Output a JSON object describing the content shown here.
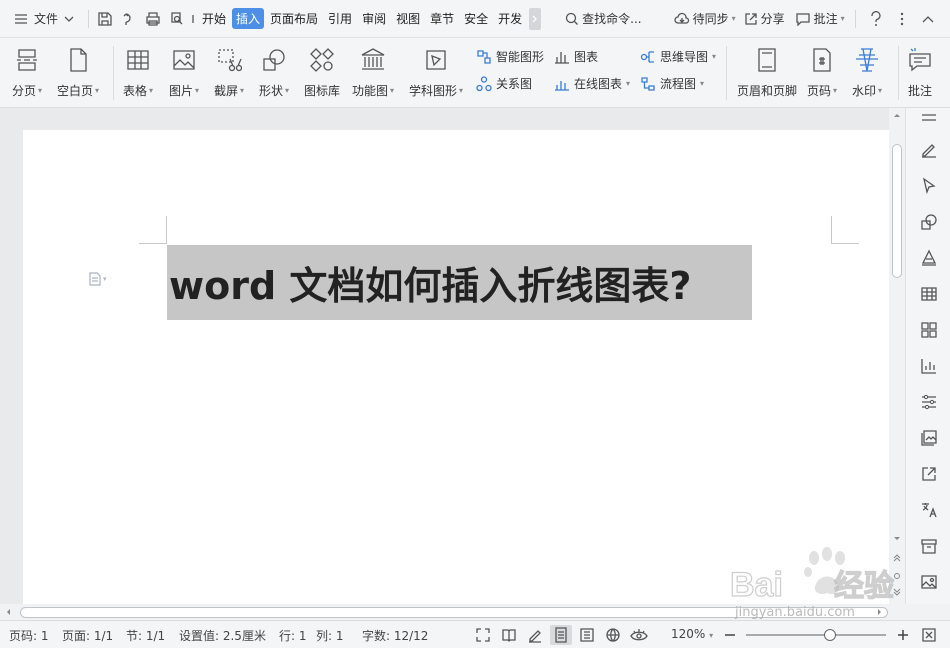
{
  "menubar": {
    "file_label": "文件",
    "tabs": [
      "开始",
      "插入",
      "页面布局",
      "引用",
      "审阅",
      "视图",
      "章节",
      "安全",
      "开发"
    ],
    "active_tab": "插入",
    "search_label": "查找命令...",
    "sync_label": "待同步",
    "share_label": "分享",
    "comment_label": "批注"
  },
  "ribbon": {
    "page_break": "分页",
    "blank_page": "空白页",
    "table": "表格",
    "picture": "图片",
    "screenshot": "截屏",
    "shape": "形状",
    "icon_lib": "图标库",
    "function_chart": "功能图",
    "subject_shape": "学科图形",
    "smart_art": "智能图形",
    "relation_chart": "关系图",
    "chart": "图表",
    "online_chart": "在线图表",
    "mind_map": "思维导图",
    "flowchart": "流程图",
    "header_footer": "页眉和页脚",
    "page_number": "页码",
    "watermark": "水印",
    "comment": "批注"
  },
  "document": {
    "heading": "word 文档如何插入折线图表?"
  },
  "statusbar": {
    "page_num": "页码: 1",
    "pages": "页面: 1/1",
    "section": "节: 1/1",
    "setting": "设置值: 2.5厘米",
    "row": "行: 1",
    "col": "列: 1",
    "word_count": "字数: 12/12",
    "zoom": "120%"
  },
  "watermark": {
    "text": "jingyan.baidu.com"
  },
  "zoom_level": 0.6
}
